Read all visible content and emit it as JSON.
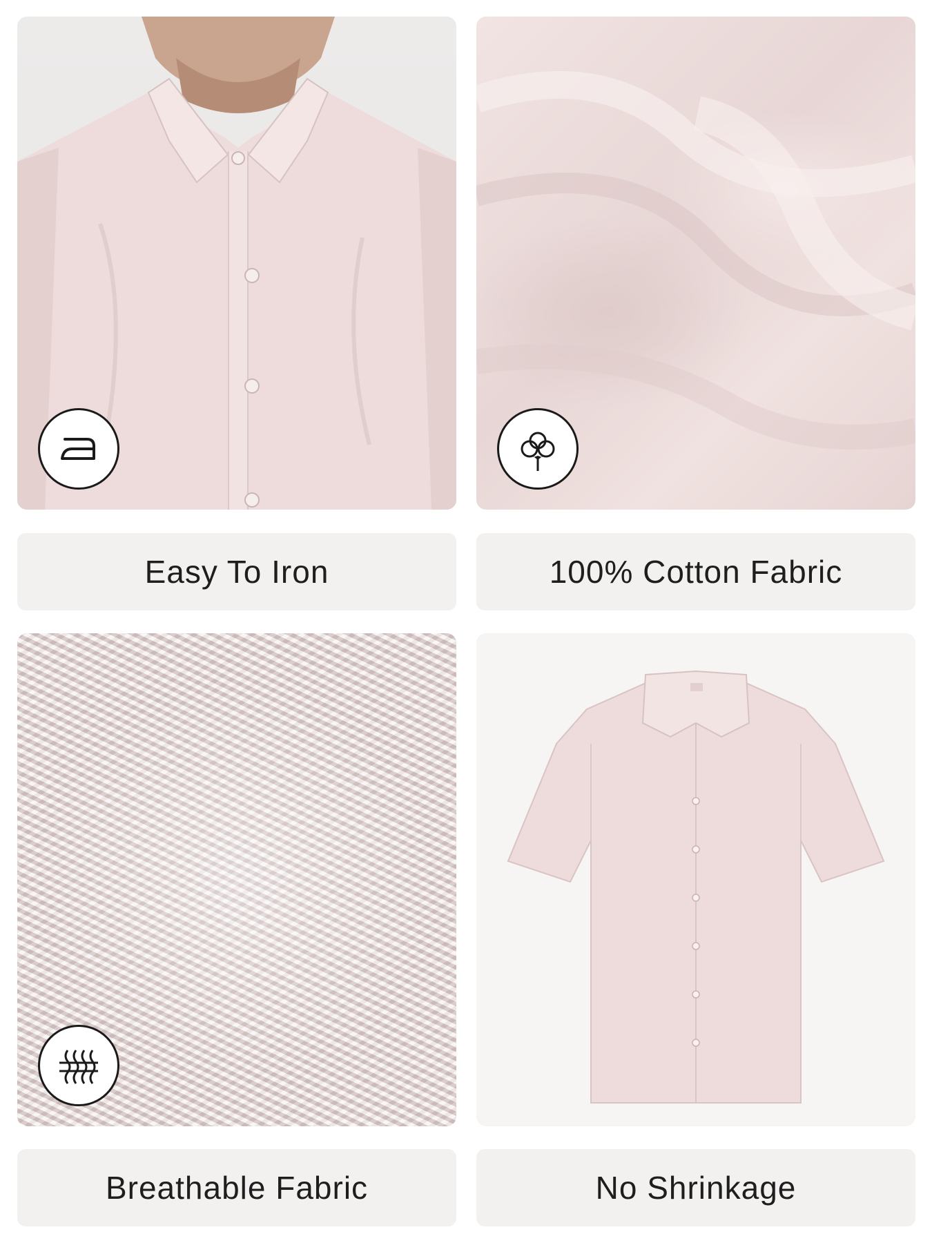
{
  "features": [
    {
      "label": "Easy To Iron",
      "icon": "iron-icon"
    },
    {
      "label": "100% Cotton Fabric",
      "icon": "cotton-flower-icon"
    },
    {
      "label": "Breathable Fabric",
      "icon": "breathable-fabric-icon"
    },
    {
      "label": "No Shrinkage",
      "icon": ""
    }
  ],
  "colors": {
    "shirt": "#eddcdb",
    "label_background": "#f2f1f0",
    "text": "#1e1e1e",
    "badge_border": "#1a1a1a"
  }
}
